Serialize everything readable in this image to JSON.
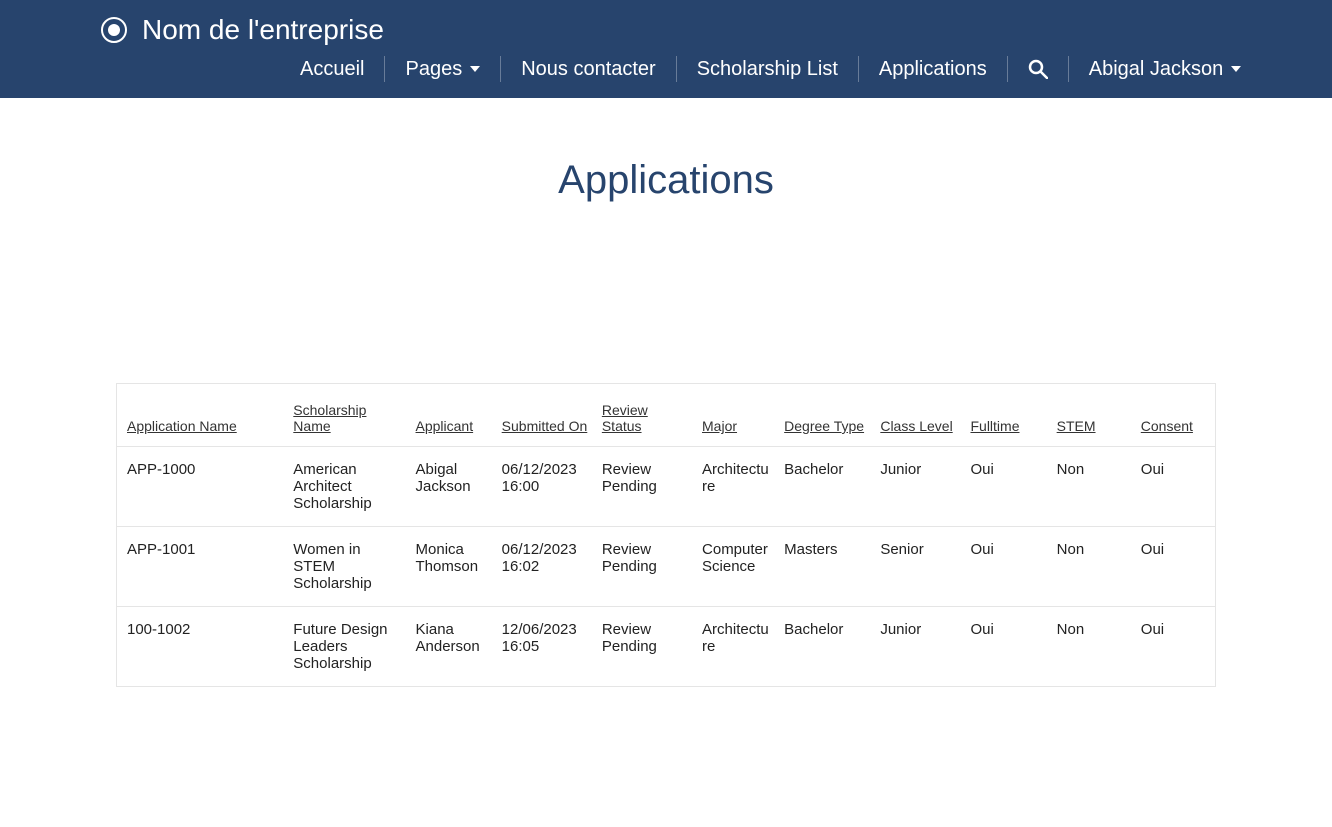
{
  "brand": "Nom de l'entreprise",
  "nav": {
    "home": "Accueil",
    "pages": "Pages",
    "contact": "Nous contacter",
    "scholarship_list": "Scholarship List",
    "applications": "Applications",
    "user": "Abigal Jackson"
  },
  "page_title": "Applications",
  "table": {
    "headers": {
      "application_name": "Application Name",
      "scholarship_name": "Scholarship Name",
      "applicant": "Applicant",
      "submitted_on": "Submitted On",
      "review_status": "Review Status",
      "major": "Major",
      "degree_type": "Degree Type",
      "class_level": "Class Level",
      "fulltime": "Fulltime",
      "stem": "STEM",
      "consent": "Consent"
    },
    "rows": [
      {
        "application_name": "APP-1000",
        "scholarship_name": "American Architect Scholarship",
        "applicant": "Abigal Jackson",
        "submitted_on": "06/12/2023 16:00",
        "review_status": "Review Pending",
        "major": "Architecture",
        "degree_type": "Bachelor",
        "class_level": "Junior",
        "fulltime": "Oui",
        "stem": "Non",
        "consent": "Oui"
      },
      {
        "application_name": "APP-1001",
        "scholarship_name": "Women in STEM Scholarship",
        "applicant": "Monica Thomson",
        "submitted_on": "06/12/2023 16:02",
        "review_status": "Review Pending",
        "major": "Computer Science",
        "degree_type": "Masters",
        "class_level": "Senior",
        "fulltime": "Oui",
        "stem": "Non",
        "consent": "Oui"
      },
      {
        "application_name": "100-1002",
        "scholarship_name": "Future Design Leaders Scholarship",
        "applicant": "Kiana Anderson",
        "submitted_on": "12/06/2023 16:05",
        "review_status": "Review Pending",
        "major": "Architecture",
        "degree_type": "Bachelor",
        "class_level": "Junior",
        "fulltime": "Oui",
        "stem": "Non",
        "consent": "Oui"
      }
    ]
  }
}
